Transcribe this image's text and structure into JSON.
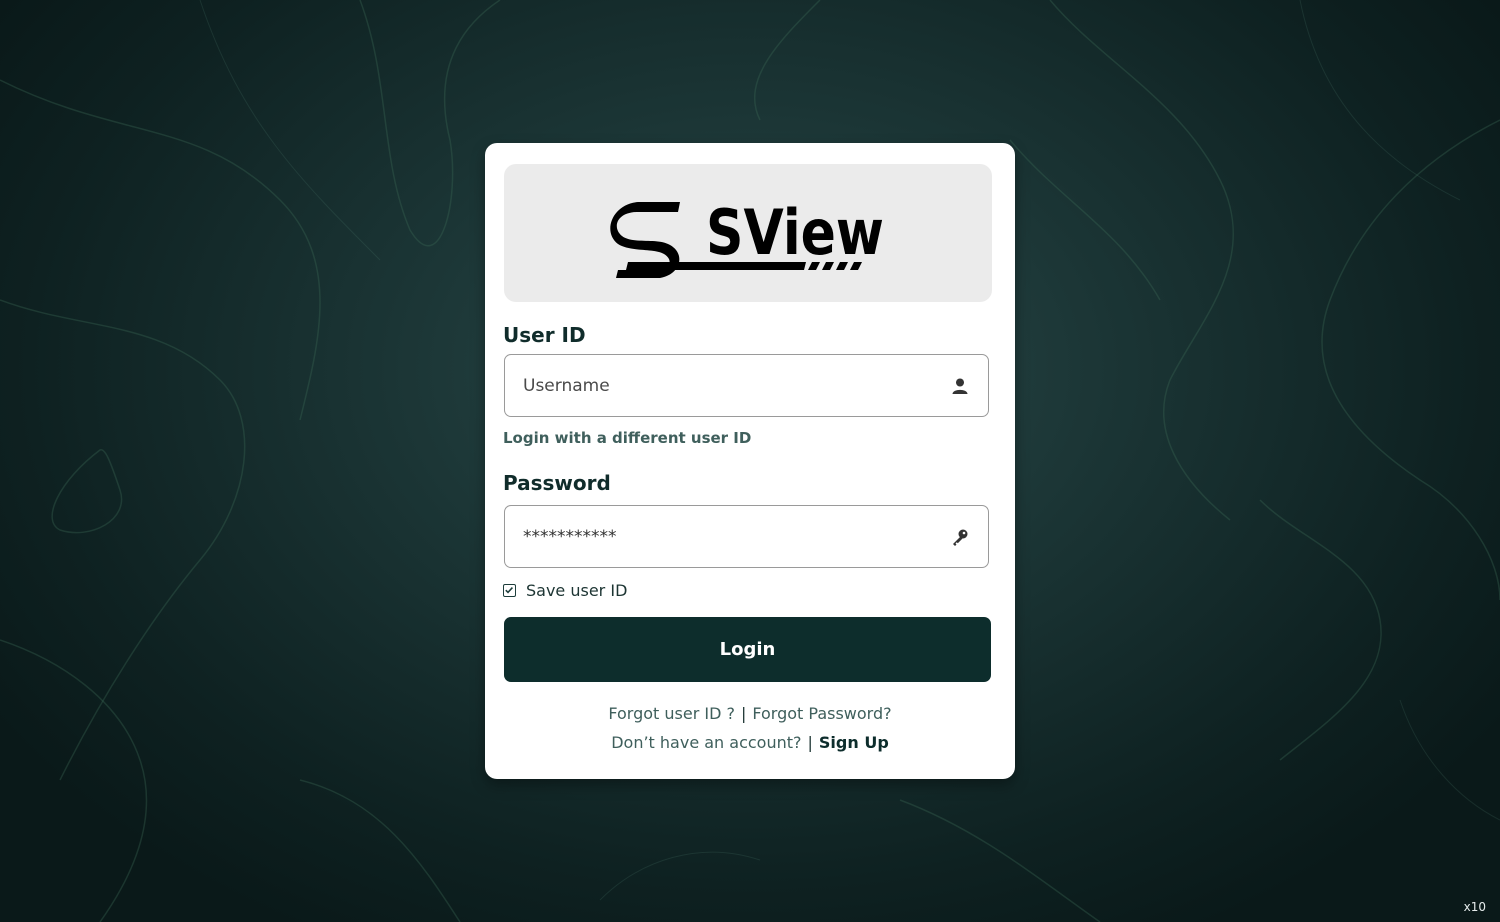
{
  "logo": {
    "text": "SView"
  },
  "user_id": {
    "label": "User ID",
    "placeholder": "Username",
    "value": "",
    "icon": "user-icon"
  },
  "alt_login_link": "Login with a different user ID",
  "password": {
    "label": "Password",
    "value": "***********",
    "icon": "key-icon"
  },
  "save_user_id": {
    "label": "Save user ID",
    "checked": true
  },
  "login_button": "Login",
  "footer": {
    "forgot_user_id": "Forgot user ID ?",
    "separator": "|",
    "forgot_password": "Forgot Password?",
    "no_account": "Don’t have an account?",
    "sign_up": "Sign Up"
  },
  "version_label": "x10",
  "colors": {
    "primary": "#0d2d2c",
    "label": "#102c2b",
    "link": "#3f5f5c",
    "background": "#1b3535"
  }
}
